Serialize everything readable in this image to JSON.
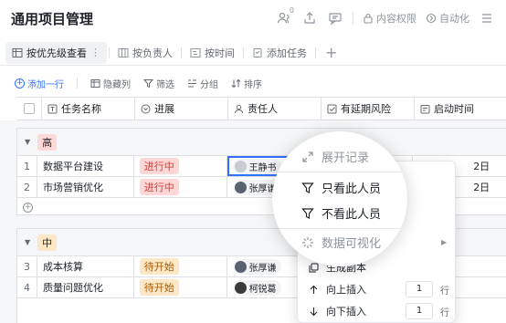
{
  "header": {
    "title": "通用项目管理",
    "notification_count": "0",
    "permissions_label": "内容权限",
    "automation_label": "自动化"
  },
  "views": {
    "tabs": [
      {
        "label": "按优先级查看",
        "active": true
      },
      {
        "label": "按负责人",
        "active": false
      },
      {
        "label": "按时间",
        "active": false
      },
      {
        "label": "添加任务",
        "active": false
      }
    ],
    "add_label": "+"
  },
  "toolbar": {
    "add_row": "添加一行",
    "hide_columns": "隐藏列",
    "filter": "筛选",
    "group": "分组",
    "sort": "排序"
  },
  "columns": [
    "任务名称",
    "进展",
    "责任人",
    "有延期风险",
    "启动时间"
  ],
  "groups": [
    {
      "tag": "高",
      "rows": [
        {
          "index": "1",
          "name": "数据平台建设",
          "status": "进行中",
          "owner": "王静书",
          "date": "2日"
        },
        {
          "index": "2",
          "name": "市场营销优化",
          "status": "进行中",
          "owner": "张厚谦",
          "date": "2日"
        }
      ]
    },
    {
      "tag": "中",
      "rows": [
        {
          "index": "3",
          "name": "成本核算",
          "status": "待开始",
          "owner": "张厚谦",
          "date": ""
        },
        {
          "index": "4",
          "name": "质量问题优化",
          "status": "待开始",
          "owner": "柯锐葛",
          "date": ""
        }
      ]
    }
  ],
  "context_menu": {
    "expand_record": "展开记录",
    "only_this_person": "只看此人员",
    "exclude_this_person": "不看此人员",
    "data_visualization": "数据可视化",
    "create_copy": "生成副本",
    "insert_above": "向上插入",
    "insert_below": "向下插入",
    "insert_above_count": "1",
    "insert_below_count": "1",
    "row_unit": "行"
  },
  "colors": {
    "accent": "#3370ff",
    "status_doing": "#d83931",
    "status_todo": "#a85a00",
    "tag_high": "#fdd8d6",
    "tag_mid": "#fde7c6"
  }
}
